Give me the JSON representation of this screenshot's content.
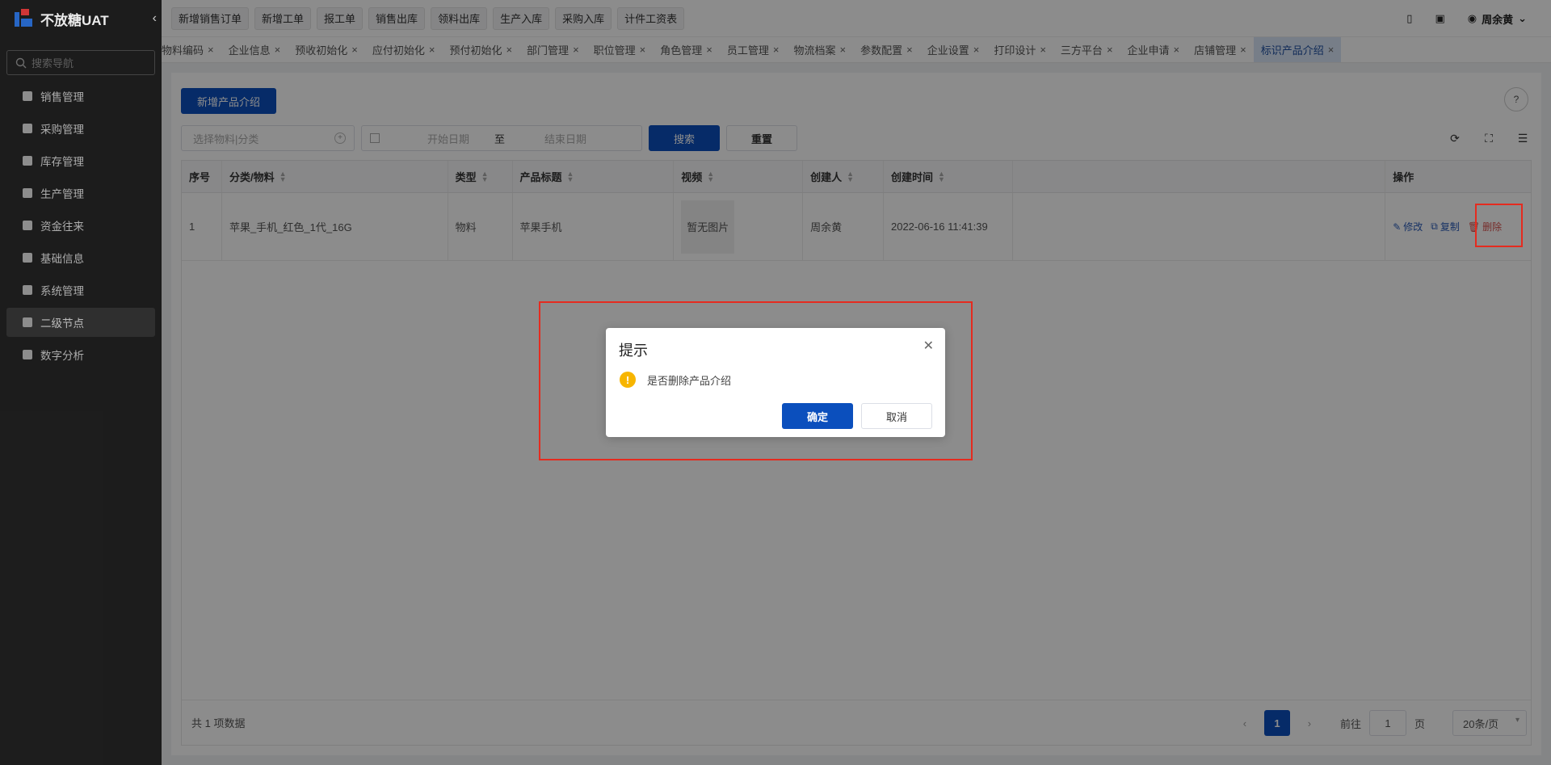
{
  "app": {
    "name": "不放糖UAT"
  },
  "sidebar": {
    "search_placeholder": "搜索导航",
    "items": [
      {
        "label": "销售管理"
      },
      {
        "label": "采购管理"
      },
      {
        "label": "库存管理"
      },
      {
        "label": "生产管理"
      },
      {
        "label": "资金往来"
      },
      {
        "label": "基础信息"
      },
      {
        "label": "系统管理"
      },
      {
        "label": "二级节点"
      },
      {
        "label": "数字分析"
      }
    ]
  },
  "topbar": {
    "quick": [
      "新增销售订单",
      "新增工单",
      "报工单",
      "销售出库",
      "领料出库",
      "生产入库",
      "采购入库",
      "计件工资表"
    ],
    "user": "周余黄"
  },
  "tabs": [
    "物料编码",
    "企业信息",
    "预收初始化",
    "应付初始化",
    "预付初始化",
    "部门管理",
    "职位管理",
    "角色管理",
    "员工管理",
    "物流档案",
    "参数配置",
    "企业设置",
    "打印设计",
    "三方平台",
    "企业申请",
    "店铺管理",
    "标识产品介绍"
  ],
  "page": {
    "add_button": "新增产品介绍",
    "select_placeholder": "选择物料|分类",
    "start_date": "开始日期",
    "date_sep": "至",
    "end_date": "结束日期",
    "search_button": "搜索",
    "reset_button": "重置"
  },
  "table": {
    "headers": [
      "序号",
      "分类/物料",
      "类型",
      "产品标题",
      "视频",
      "创建人",
      "创建时间",
      "",
      "操作"
    ],
    "rows": [
      {
        "index": "1",
        "material": "苹果_手机_红色_1代_16G",
        "type": "物料",
        "title": "苹果手机",
        "video": "暂无图片",
        "creator": "周余黄",
        "created": "2022-06-16 11:41:39"
      }
    ],
    "ops": {
      "edit": "修改",
      "copy": "复制",
      "delete": "删除"
    }
  },
  "footer": {
    "total": "共 1 项数据",
    "page": "1",
    "goto_prefix": "前往",
    "goto_value": "1",
    "goto_suffix": "页",
    "page_size": "20条/页"
  },
  "dialog": {
    "title": "提示",
    "message": "是否删除产品介绍",
    "ok": "确定",
    "cancel": "取消"
  },
  "colors": {
    "primary": "#0b4fbd",
    "highlight": "#e52b1f",
    "warning": "#f7b500"
  }
}
